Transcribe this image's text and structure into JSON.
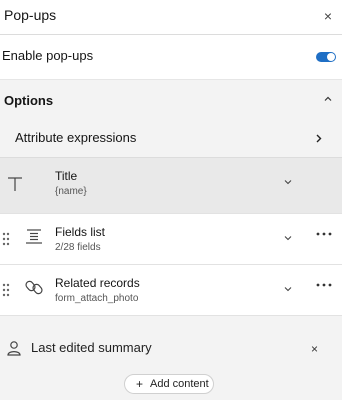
{
  "panel": {
    "title": "Pop-ups",
    "close_label": "×"
  },
  "enable": {
    "label": "Enable pop-ups",
    "on": true,
    "accent": "#1f6fc5"
  },
  "options": {
    "label": "Options",
    "attribute_expressions": "Attribute expressions",
    "items": [
      {
        "name": "Title",
        "sub": "{name}"
      },
      {
        "name": "Fields list",
        "sub": "2/28 fields"
      },
      {
        "name": "Related records",
        "sub": "form_attach_photo"
      }
    ],
    "summary": {
      "label": "Last edited summary",
      "close_label": "×"
    }
  },
  "add_content": {
    "label": "Add content",
    "plus": "+"
  },
  "icons": [
    "close-icon",
    "toggle",
    "chevron-up-icon",
    "chevron-right-icon",
    "text-icon",
    "chevron-down-icon",
    "drag-handle-icon",
    "fields-list-icon",
    "link-icon",
    "more-icon",
    "person-icon",
    "plus-icon"
  ]
}
